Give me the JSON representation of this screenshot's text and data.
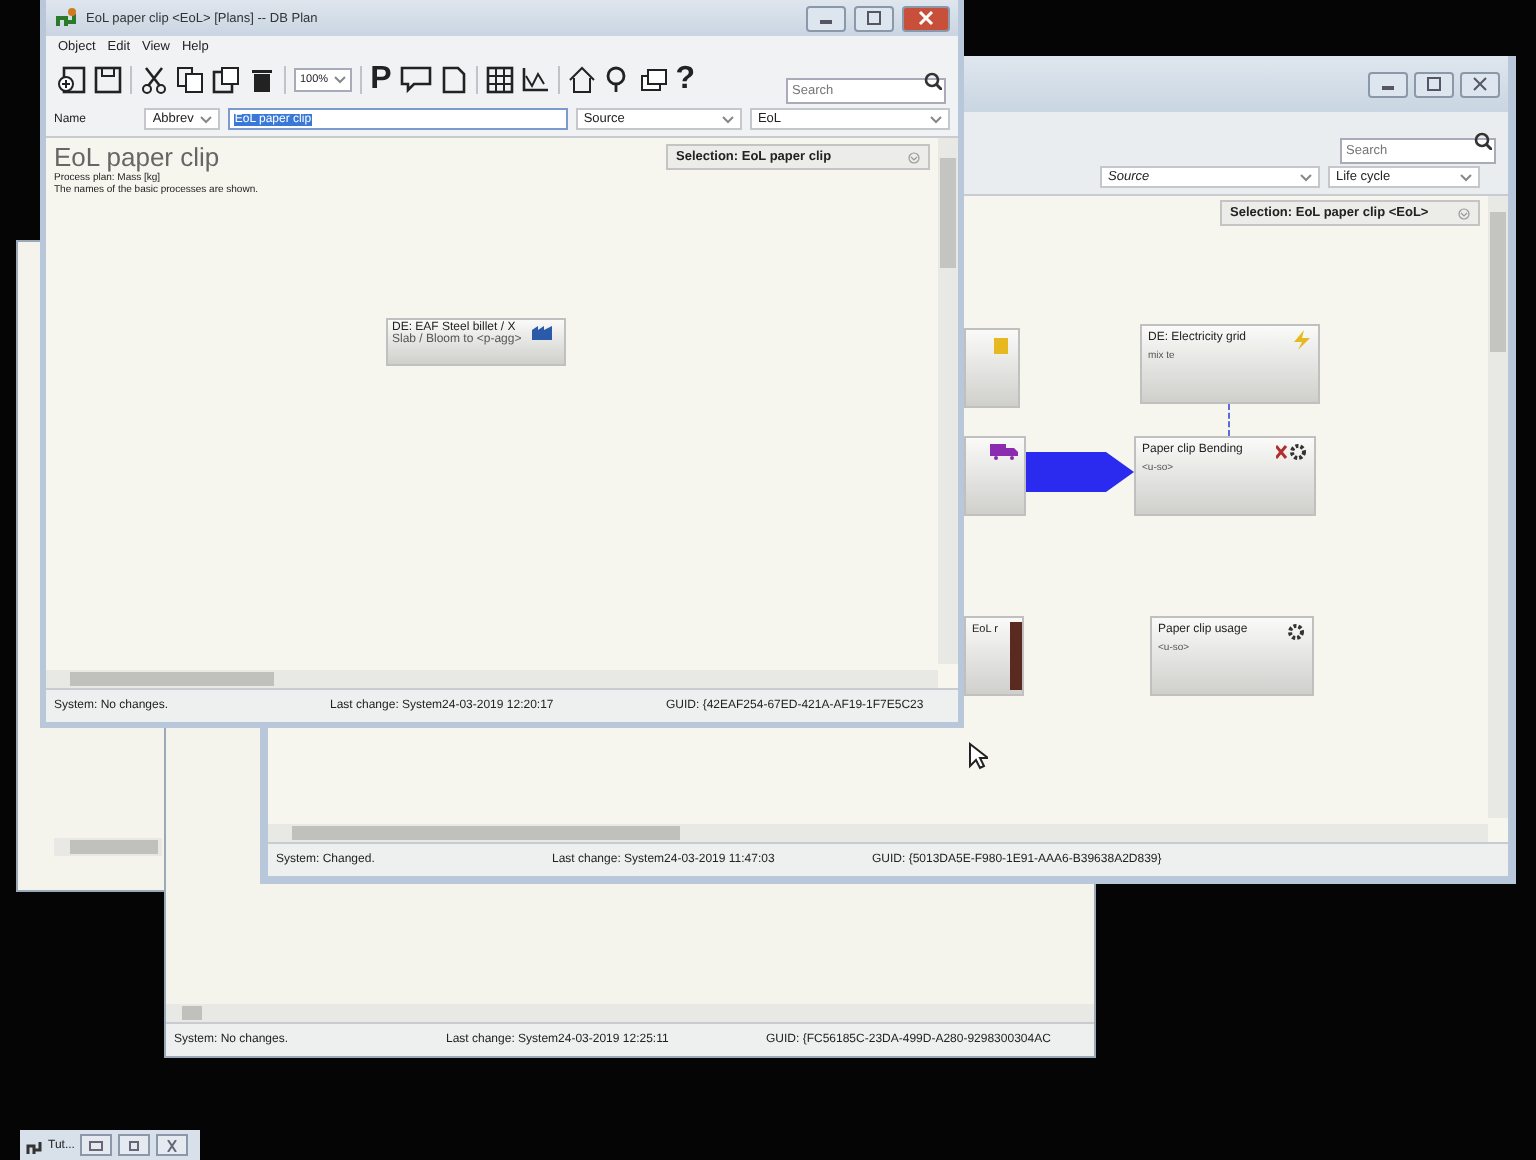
{
  "windows": [
    {
      "kind": "back"
    },
    {
      "kind": "middle",
      "status": [
        "System: No changes.",
        "Last change: System24-03-2019 12:25:11",
        "GUID: {FC56185C-23DA-499D-A280-9298300304AC"
      ]
    },
    {
      "kind": "diagram",
      "search": {
        "placeholder": "Search"
      },
      "source": {
        "placeholder": "Source"
      },
      "life_cycle": "Life cycle",
      "selection": "Selection: EoL paper clip <EoL>",
      "nodes": [
        {
          "kind": "fuel"
        },
        {
          "kind": "power",
          "title": "DE: Electricity grid",
          "subtitle": "mix te"
        },
        {
          "kind": "truck"
        },
        {
          "kind": "process",
          "title": "Paper clip Bending",
          "subtitle": "<u-so>"
        },
        {
          "kind": "eol",
          "title": "EoL r"
        },
        {
          "kind": "gear",
          "title": "Paper clip usage",
          "subtitle": "<u-so>"
        }
      ],
      "status": [
        "System: Changed.",
        "Last change: System24-03-2019 11:47:03",
        "GUID: {5013DA5E-F980-1E91-AAA6-B39638A2D839}"
      ]
    },
    {
      "kind": "plan",
      "title": "EoL paper clip <EoL> [Plans] -- DB Plan",
      "menu": [
        "Object",
        "Edit",
        "View",
        "Help"
      ],
      "zoom": "100%",
      "glyphs": [
        "P",
        "?"
      ],
      "search": {
        "placeholder": "Search"
      },
      "name_label": "Name",
      "abbr": "Abbrev",
      "name_value": "EoL paper clip",
      "source": {
        "placeholder": "Source"
      },
      "life_cycle": "EoL",
      "heading": "EoL paper clip",
      "lines": [
        "Process plan: Mass [kg]",
        "The names of the basic processes are shown."
      ],
      "selection": "Selection: EoL paper clip",
      "node": {
        "title": "DE: EAF Steel billet / X",
        "subtitle": "Slab / Bloom to <p-agg>"
      },
      "status": [
        "System: No changes.",
        "Last change: System24-03-2019 12:20:17",
        "GUID: {42EAF254-67ED-421A-AF19-1F7E5C23"
      ]
    }
  ],
  "taskbar": {
    "label": "Tut..."
  }
}
